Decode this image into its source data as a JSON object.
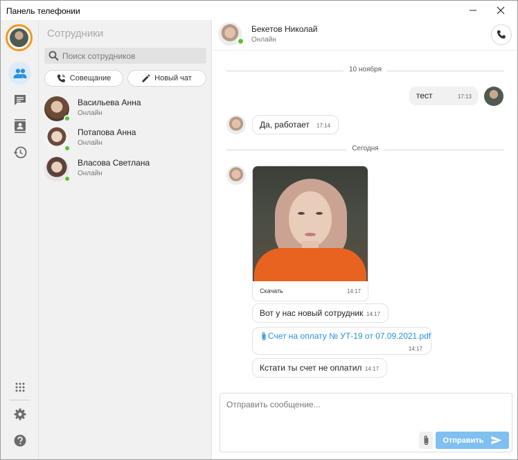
{
  "window": {
    "title": "Панель телефонии"
  },
  "contacts_panel": {
    "heading": "Сотрудники",
    "search_placeholder": "Поиск сотрудников",
    "meeting_label": "Совещание",
    "new_chat_label": "Новый чат",
    "items": [
      {
        "name": "Васильева Анна",
        "status": "Онлайн"
      },
      {
        "name": "Потапова Анна",
        "status": "Онлайн"
      },
      {
        "name": "Власова Светлана",
        "status": "Онлайн"
      }
    ]
  },
  "chat": {
    "contact_name": "Бекетов Николай",
    "contact_status": "Онлайн",
    "separators": [
      "10 ноября",
      "Сегодня"
    ],
    "messages": [
      {
        "text": "тест",
        "time": "17:13"
      },
      {
        "text": "Да, работает",
        "time": "17:14"
      },
      {
        "download_label": "Скачать",
        "time": "14:17"
      },
      {
        "text": "Вот у нас новый сотрудник",
        "time": "14:17"
      },
      {
        "file_name": "Счет на оплату № УТ-19 от 07.09.2021.pdf",
        "time": "14:17"
      },
      {
        "text": "Кстати ты счет не оплатил",
        "time": "14:17"
      }
    ]
  },
  "composer": {
    "placeholder": "Отправить сообщение...",
    "send_label": "Отправить"
  },
  "colors": {
    "accent": "#2a8fdc",
    "online": "#5cbf3a",
    "user_ring": "#f5961e",
    "send_button": "#7fc0f1"
  },
  "icons": {
    "rail": [
      "people-icon",
      "chat-icon",
      "contacts-book-icon",
      "history-icon",
      "dialpad-icon",
      "gear-icon",
      "help-icon"
    ],
    "window": [
      "minimize-icon",
      "close-icon"
    ],
    "misc": [
      "search-icon",
      "phone-icon",
      "pencil-icon",
      "paperclip-icon",
      "send-icon"
    ]
  }
}
